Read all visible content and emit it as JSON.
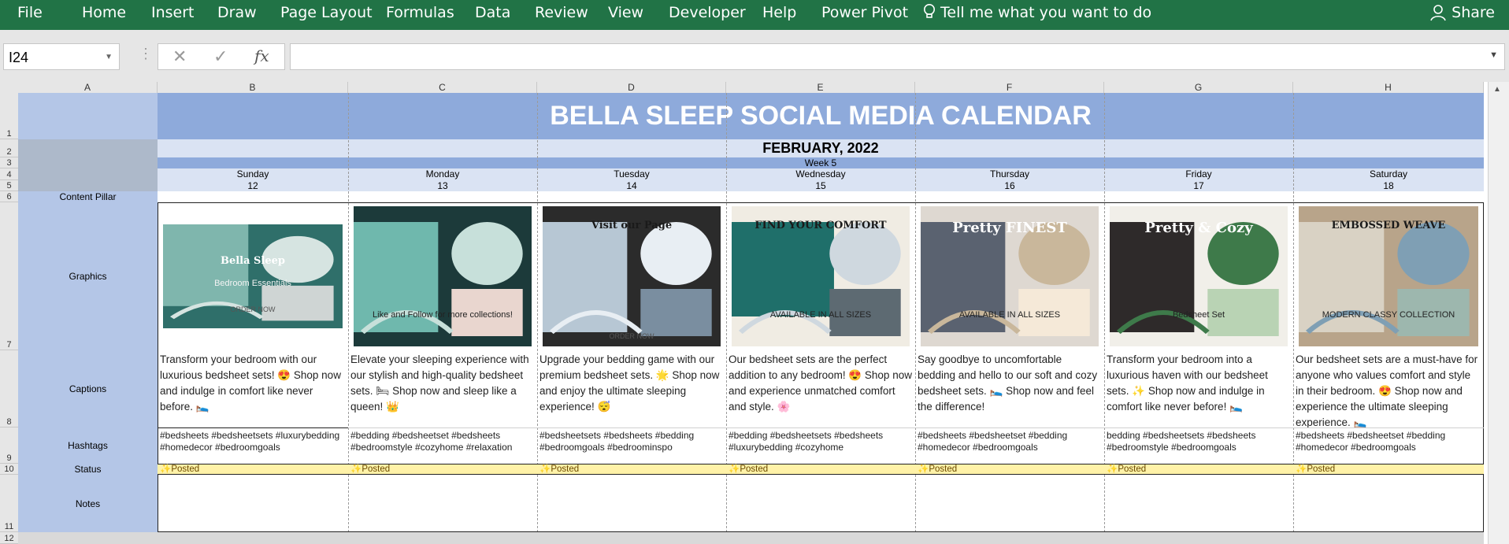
{
  "ribbon": {
    "tabs": [
      "File",
      "Home",
      "Insert",
      "Draw",
      "Page Layout",
      "Formulas",
      "Data",
      "Review",
      "View",
      "Developer",
      "Help",
      "Power Pivot"
    ],
    "tell_me": "Tell me what you want to do",
    "share": "Share"
  },
  "formula_bar": {
    "name_box": "I24",
    "formula": ""
  },
  "columns": [
    "A",
    "B",
    "C",
    "D",
    "E",
    "F",
    "G",
    "H"
  ],
  "rows": [
    "1",
    "2",
    "3",
    "4",
    "5",
    "6",
    "7",
    "8",
    "9",
    "10",
    "11",
    "12"
  ],
  "sheet": {
    "title": "BELLA SLEEP SOCIAL MEDIA CALENDAR",
    "month": "FEBRUARY, 2022",
    "week": "Week 5",
    "labels": {
      "content_pillar": "Content Pillar",
      "graphics": "Graphics",
      "captions": "Captions",
      "hashtags": "Hashtags",
      "status": "Status",
      "notes": "Notes"
    },
    "days": [
      {
        "name": "Sunday",
        "date": "12",
        "caption": "Transform your bedroom with our luxurious bedsheet sets! 😍 Shop now and indulge in comfort like never before. 🛌",
        "hashtags": "#bedsheets #bedsheetsets #luxurybedding #homedecor #bedroomgoals",
        "status": "✨Posted",
        "graphic": {
          "headline": "Bella Sleep",
          "sub": "Bedroom Essentials",
          "cta": "ORDER NOW"
        }
      },
      {
        "name": "Monday",
        "date": "13",
        "caption": "Elevate your sleeping experience with our stylish and high-quality bedsheet sets. 🛏 Shop now and sleep like a queen! 👑",
        "hashtags": "#bedding #bedsheetset #bedsheets #bedroomstyle #cozyhome #relaxation",
        "status": "✨Posted",
        "graphic": {
          "headline": "",
          "sub": "Like and Follow for more collections!",
          "cta": ""
        }
      },
      {
        "name": "Tuesday",
        "date": "14",
        "caption": "Upgrade your bedding game with our premium bedsheet sets. 🌟 Shop now and enjoy the ultimate sleeping experience! 😴",
        "hashtags": "#bedsheetsets #bedsheets #bedding #bedroomgoals #bedroominspo",
        "status": "✨Posted",
        "graphic": {
          "headline": "Visit our Page",
          "sub": "",
          "cta": "ORDER NOW"
        }
      },
      {
        "name": "Wednesday",
        "date": "15",
        "caption": "Our bedsheet sets are the perfect addition to any bedroom! 😍 Shop now and experience unmatched comfort and style. 🌸",
        "hashtags": "#bedding #bedsheetsets #bedsheets #luxurybedding #cozyhome",
        "status": "✨Posted",
        "graphic": {
          "headline": "FIND YOUR COMFORT",
          "sub": "AVAILABLE IN ALL SIZES",
          "cta": ""
        }
      },
      {
        "name": "Thursday",
        "date": "16",
        "caption": "Say goodbye to uncomfortable bedding and hello to our soft and cozy bedsheet sets. 🛌 Shop now and feel the difference!",
        "hashtags": "#bedsheets #bedsheetset #bedding #homedecor #bedroomgoals",
        "status": "✨Posted",
        "graphic": {
          "headline": "Pretty FINEST",
          "sub": "AVAILABLE IN ALL SIZES",
          "cta": ""
        }
      },
      {
        "name": "Friday",
        "date": "17",
        "caption": "Transform your bedroom into a luxurious haven with our bedsheet sets. ✨ Shop now and indulge in comfort like never before! 🛌",
        "hashtags": "bedding #bedsheetsets #bedsheets #bedroomstyle #bedroomgoals",
        "status": "✨Posted",
        "graphic": {
          "headline": "Pretty & Cozy",
          "sub": "Bedsheet Set",
          "cta": ""
        }
      },
      {
        "name": "Saturday",
        "date": "18",
        "caption": "Our bedsheet sets are a must-have for anyone who values comfort and style in their bedroom. 😍 Shop now and experience the ultimate sleeping experience. 🛌",
        "hashtags": "#bedsheets #bedsheetset #bedding #homedecor #bedroomgoals",
        "status": "✨Posted",
        "graphic": {
          "headline": "EMBOSSED WEAVE",
          "sub": "MODERN CLASSY COLLECTION",
          "cta": ""
        }
      }
    ]
  },
  "colors": {
    "ribbon": "#217346",
    "title_band": "#8eaadb",
    "label_col": "#b4c6e7",
    "status_band": "#fff2a8"
  },
  "icons": {
    "lightbulb": "lightbulb-icon",
    "share": "person-icon",
    "cancel": "x-icon",
    "enter": "check-icon",
    "fx": "function-icon",
    "dropdown": "chevron-down-icon"
  }
}
